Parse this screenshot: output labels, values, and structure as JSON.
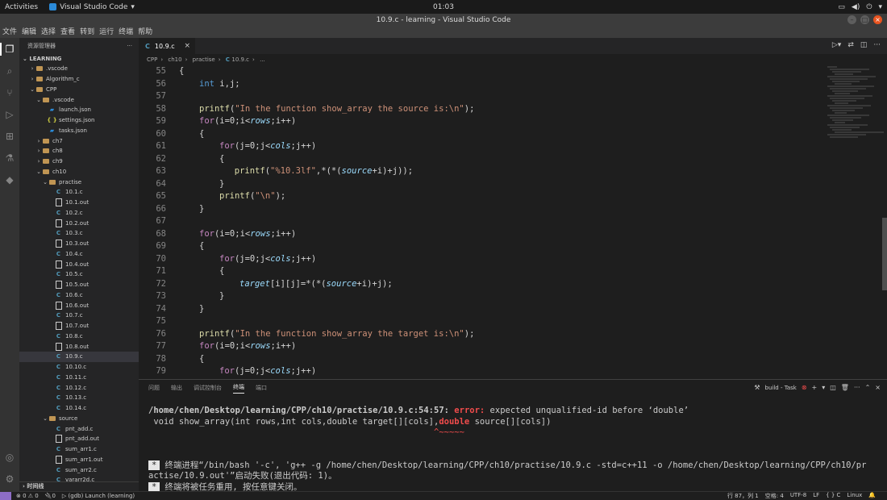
{
  "topbar": {
    "activities": "Activities",
    "app_name": "Visual Studio Code",
    "clock": "01:03"
  },
  "window": {
    "title": "10.9.c - learning - Visual Studio Code"
  },
  "menu": [
    "文件",
    "编辑",
    "选择",
    "查看",
    "转到",
    "运行",
    "终端",
    "帮助"
  ],
  "sidebar": {
    "header": "资源管理器",
    "section": "LEARNING",
    "items": [
      {
        "label": ".vscode",
        "kind": "folder",
        "indent": 1,
        "chev": "›"
      },
      {
        "label": "Algorithm_c",
        "kind": "folder",
        "indent": 1,
        "chev": "›"
      },
      {
        "label": "CPP",
        "kind": "folder",
        "indent": 1,
        "chev": "⌄"
      },
      {
        "label": ".vscode",
        "kind": "folder",
        "indent": 2,
        "chev": "⌄"
      },
      {
        "label": "launch.json",
        "kind": "jsonvs",
        "indent": 3,
        "chev": ""
      },
      {
        "label": "settings.json",
        "kind": "json",
        "indent": 3,
        "chev": ""
      },
      {
        "label": "tasks.json",
        "kind": "jsonvs",
        "indent": 3,
        "chev": ""
      },
      {
        "label": "ch7",
        "kind": "folder",
        "indent": 2,
        "chev": "›"
      },
      {
        "label": "ch8",
        "kind": "folder",
        "indent": 2,
        "chev": "›"
      },
      {
        "label": "ch9",
        "kind": "folder",
        "indent": 2,
        "chev": "›"
      },
      {
        "label": "ch10",
        "kind": "folder",
        "indent": 2,
        "chev": "⌄"
      },
      {
        "label": "practise",
        "kind": "folder",
        "indent": 3,
        "chev": "⌄"
      },
      {
        "label": "10.1.c",
        "kind": "c",
        "indent": 4,
        "chev": ""
      },
      {
        "label": "10.1.out",
        "kind": "out",
        "indent": 4,
        "chev": ""
      },
      {
        "label": "10.2.c",
        "kind": "c",
        "indent": 4,
        "chev": ""
      },
      {
        "label": "10.2.out",
        "kind": "out",
        "indent": 4,
        "chev": ""
      },
      {
        "label": "10.3.c",
        "kind": "c",
        "indent": 4,
        "chev": ""
      },
      {
        "label": "10.3.out",
        "kind": "out",
        "indent": 4,
        "chev": ""
      },
      {
        "label": "10.4.c",
        "kind": "c",
        "indent": 4,
        "chev": ""
      },
      {
        "label": "10.4.out",
        "kind": "out",
        "indent": 4,
        "chev": ""
      },
      {
        "label": "10.5.c",
        "kind": "c",
        "indent": 4,
        "chev": ""
      },
      {
        "label": "10.5.out",
        "kind": "out",
        "indent": 4,
        "chev": ""
      },
      {
        "label": "10.6.c",
        "kind": "c",
        "indent": 4,
        "chev": ""
      },
      {
        "label": "10.6.out",
        "kind": "out",
        "indent": 4,
        "chev": ""
      },
      {
        "label": "10.7.c",
        "kind": "c",
        "indent": 4,
        "chev": ""
      },
      {
        "label": "10.7.out",
        "kind": "out",
        "indent": 4,
        "chev": ""
      },
      {
        "label": "10.8.c",
        "kind": "c",
        "indent": 4,
        "chev": ""
      },
      {
        "label": "10.8.out",
        "kind": "out",
        "indent": 4,
        "chev": ""
      },
      {
        "label": "10.9.c",
        "kind": "c",
        "indent": 4,
        "chev": "",
        "selected": true
      },
      {
        "label": "10.10.c",
        "kind": "c",
        "indent": 4,
        "chev": ""
      },
      {
        "label": "10.11.c",
        "kind": "c",
        "indent": 4,
        "chev": ""
      },
      {
        "label": "10.12.c",
        "kind": "c",
        "indent": 4,
        "chev": ""
      },
      {
        "label": "10.13.c",
        "kind": "c",
        "indent": 4,
        "chev": ""
      },
      {
        "label": "10.14.c",
        "kind": "c",
        "indent": 4,
        "chev": ""
      },
      {
        "label": "source",
        "kind": "folder",
        "indent": 3,
        "chev": "⌄"
      },
      {
        "label": "pnt_add.c",
        "kind": "c",
        "indent": 4,
        "chev": ""
      },
      {
        "label": "pnt_add.out",
        "kind": "out",
        "indent": 4,
        "chev": ""
      },
      {
        "label": "sum_arr1.c",
        "kind": "c",
        "indent": 4,
        "chev": ""
      },
      {
        "label": "sum_arr1.out",
        "kind": "out",
        "indent": 4,
        "chev": ""
      },
      {
        "label": "sum_arr2.c",
        "kind": "c",
        "indent": 4,
        "chev": ""
      },
      {
        "label": "vararr2d.c",
        "kind": "c",
        "indent": 4,
        "chev": ""
      }
    ],
    "bottom_section": "时间线"
  },
  "editor": {
    "tab": "10.9.c",
    "breadcrumb": [
      "CPP",
      "ch10",
      "practise",
      "10.9.c",
      "..."
    ],
    "lines": [
      {
        "n": "55",
        "indent": 0,
        "tokens": [
          [
            "op",
            "{"
          ]
        ]
      },
      {
        "n": "56",
        "indent": 1,
        "tokens": [
          [
            "kw",
            "int"
          ],
          [
            "op",
            " i,j;"
          ]
        ]
      },
      {
        "n": "57",
        "indent": 0,
        "tokens": []
      },
      {
        "n": "58",
        "indent": 1,
        "tokens": [
          [
            "fn",
            "printf"
          ],
          [
            "op",
            "("
          ],
          [
            "str",
            "\"In the function show_array the source is:\\n\""
          ],
          [
            "op",
            ");"
          ]
        ]
      },
      {
        "n": "59",
        "indent": 1,
        "tokens": [
          [
            "ctl",
            "for"
          ],
          [
            "op",
            "(i=0;i<"
          ],
          [
            "param",
            "rows"
          ],
          [
            "op",
            ";i++)"
          ]
        ]
      },
      {
        "n": "60",
        "indent": 1,
        "tokens": [
          [
            "op",
            "{"
          ]
        ]
      },
      {
        "n": "61",
        "indent": 2,
        "tokens": [
          [
            "ctl",
            "for"
          ],
          [
            "op",
            "(j=0;j<"
          ],
          [
            "param",
            "cols"
          ],
          [
            "op",
            ";j++)"
          ]
        ]
      },
      {
        "n": "62",
        "indent": 2,
        "tokens": [
          [
            "op",
            "{"
          ]
        ]
      },
      {
        "n": "63",
        "indent": 2.75,
        "tokens": [
          [
            "fn",
            "printf"
          ],
          [
            "op",
            "("
          ],
          [
            "str",
            "\"%10.3lf\""
          ],
          [
            "op",
            ",*(*("
          ],
          [
            "param",
            "source"
          ],
          [
            "op",
            "+i)+j));"
          ]
        ]
      },
      {
        "n": "64",
        "indent": 2,
        "tokens": [
          [
            "op",
            "}"
          ]
        ]
      },
      {
        "n": "65",
        "indent": 2,
        "tokens": [
          [
            "fn",
            "printf"
          ],
          [
            "op",
            "("
          ],
          [
            "str",
            "\"\\n\""
          ],
          [
            "op",
            ");"
          ]
        ]
      },
      {
        "n": "66",
        "indent": 1,
        "tokens": [
          [
            "op",
            "}"
          ]
        ]
      },
      {
        "n": "67",
        "indent": 0,
        "tokens": []
      },
      {
        "n": "68",
        "indent": 1,
        "tokens": [
          [
            "ctl",
            "for"
          ],
          [
            "op",
            "(i=0;i<"
          ],
          [
            "param",
            "rows"
          ],
          [
            "op",
            ";i++)"
          ]
        ]
      },
      {
        "n": "69",
        "indent": 1,
        "tokens": [
          [
            "op",
            "{"
          ]
        ]
      },
      {
        "n": "70",
        "indent": 2,
        "tokens": [
          [
            "ctl",
            "for"
          ],
          [
            "op",
            "(j=0;j<"
          ],
          [
            "param",
            "cols"
          ],
          [
            "op",
            ";j++)"
          ]
        ]
      },
      {
        "n": "71",
        "indent": 2,
        "tokens": [
          [
            "op",
            "{"
          ]
        ]
      },
      {
        "n": "72",
        "indent": 3,
        "tokens": [
          [
            "param",
            "target"
          ],
          [
            "op",
            "[i][j]=*(*("
          ],
          [
            "param",
            "source"
          ],
          [
            "op",
            "+i)+j);"
          ]
        ]
      },
      {
        "n": "73",
        "indent": 2,
        "tokens": [
          [
            "op",
            "}"
          ]
        ]
      },
      {
        "n": "74",
        "indent": 1,
        "tokens": [
          [
            "op",
            "}"
          ]
        ]
      },
      {
        "n": "75",
        "indent": 0,
        "tokens": []
      },
      {
        "n": "76",
        "indent": 1,
        "tokens": [
          [
            "fn",
            "printf"
          ],
          [
            "op",
            "("
          ],
          [
            "str",
            "\"In the function show_array the target is:\\n\""
          ],
          [
            "op",
            ");"
          ]
        ]
      },
      {
        "n": "77",
        "indent": 1,
        "tokens": [
          [
            "ctl",
            "for"
          ],
          [
            "op",
            "(i=0;i<"
          ],
          [
            "param",
            "rows"
          ],
          [
            "op",
            ";i++)"
          ]
        ]
      },
      {
        "n": "78",
        "indent": 1,
        "tokens": [
          [
            "op",
            "{"
          ]
        ]
      },
      {
        "n": "79",
        "indent": 2,
        "tokens": [
          [
            "ctl",
            "for"
          ],
          [
            "op",
            "(j=0;j<"
          ],
          [
            "param",
            "cols"
          ],
          [
            "op",
            ";j++)"
          ]
        ]
      }
    ]
  },
  "panel": {
    "tabs": [
      "问题",
      "输出",
      "调试控制台",
      "终端",
      "端口"
    ],
    "active_tab": "终端",
    "task": "build - Task",
    "terminal": {
      "error_path": "/home/chen/Desktop/learning/CPP/ch10/practise/10.9.c:54:57: ",
      "error_word": "error:",
      "error_msg": " expected unqualified-id before ‘double’",
      "src_pre": " void show_array(int rows,int cols,double target[][cols],",
      "src_err": "double",
      "src_post": " source[][cols])",
      "squiggle": "                                                        ^~~~~~",
      "line1a": "终端进程“/bin/bash '-c', 'g++ -g /home/chen/Desktop/learning/CPP/ch10/practise/10.9.c -std=c++11 -o /home/chen/Desktop/learning/CPP/ch10/pr",
      "line1b": "actise/10.9.out'”启动失败(退出代码: 1)。",
      "line2": "终端将被任务重用, 按任意键关闭。"
    }
  },
  "status": {
    "problems": "⊗ 0 ⚠ 0",
    "ports": "🔌0",
    "debug": "▷ (gdb) Launch (learning)",
    "cursor": "行 87，列 1",
    "spaces": "空格: 4",
    "encoding": "UTF-8",
    "eol": "LF",
    "lang_mode": "{ } C",
    "platform": "Linux"
  }
}
